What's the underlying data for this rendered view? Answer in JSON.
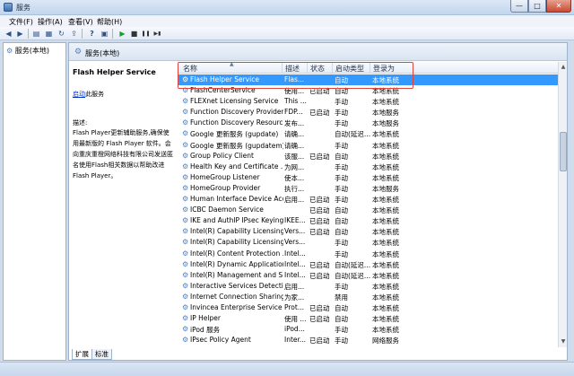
{
  "window": {
    "title": "服务",
    "controls": {
      "minimize": "—",
      "maximize": "□",
      "close": "✕"
    }
  },
  "menu": [
    "文件(F)",
    "操作(A)",
    "查看(V)",
    "帮助(H)"
  ],
  "toolbar": {
    "icons": [
      "back-icon",
      "forward-icon",
      "console-tree-icon",
      "properties-icon",
      "refresh-icon",
      "export-icon",
      "help-icon",
      "view-icon",
      "play-icon",
      "stop-icon",
      "pause-icon",
      "restart-icon"
    ],
    "glyphs": {
      "back": "◀",
      "forward": "▶",
      "tree": "▤",
      "props": "▦",
      "refresh": "↻",
      "export": "⇪",
      "help": "?",
      "view": "▣",
      "play": "▶",
      "stop": "■",
      "pause": "❚❚",
      "restart": "▶▮"
    }
  },
  "tree": {
    "node_label": "服务(本地)"
  },
  "header": {
    "title": "服务(本地)"
  },
  "detail": {
    "service_title": "Flash Helper Service",
    "start_link": "启动",
    "start_suffix": "此服务",
    "description_label": "描述:",
    "description": "Flash Player更新辅助服务,确保使用最新版的 Flash Player 软件。会向重庆重橙网络科技有限公司发送匿名使用Flash相关数据以帮助改进 Flash Player。"
  },
  "columns": {
    "name": "名称",
    "description": "描述",
    "status": "状态",
    "startup": "启动类型",
    "logon": "登录为"
  },
  "rows": [
    {
      "name": "Flash Helper Service",
      "desc": "Flas...",
      "status": "",
      "startup": "自动",
      "logon": "本地系统"
    },
    {
      "name": "FlashCenterService",
      "desc": "使用...",
      "status": "已启动",
      "startup": "自动",
      "logon": "本地系统"
    },
    {
      "name": "FLEXnet Licensing Service",
      "desc": "This ...",
      "status": "",
      "startup": "手动",
      "logon": "本地系统"
    },
    {
      "name": "Function Discovery Provider ...",
      "desc": "FDP...",
      "status": "已启动",
      "startup": "手动",
      "logon": "本地服务"
    },
    {
      "name": "Function Discovery Resourc...",
      "desc": "发布...",
      "status": "",
      "startup": "手动",
      "logon": "本地服务"
    },
    {
      "name": "Google 更新服务 (gupdate)",
      "desc": "请确...",
      "status": "",
      "startup": "自动(延迟...",
      "logon": "本地系统"
    },
    {
      "name": "Google 更新服务 (gupdatem)",
      "desc": "请确...",
      "status": "",
      "startup": "手动",
      "logon": "本地系统"
    },
    {
      "name": "Group Policy Client",
      "desc": "该服...",
      "status": "已启动",
      "startup": "自动",
      "logon": "本地系统"
    },
    {
      "name": "Health Key and Certificate ...",
      "desc": "为网...",
      "status": "",
      "startup": "手动",
      "logon": "本地系统"
    },
    {
      "name": "HomeGroup Listener",
      "desc": "使本...",
      "status": "",
      "startup": "手动",
      "logon": "本地系统"
    },
    {
      "name": "HomeGroup Provider",
      "desc": "执行...",
      "status": "",
      "startup": "手动",
      "logon": "本地服务"
    },
    {
      "name": "Human Interface Device Acc...",
      "desc": "启用...",
      "status": "已启动",
      "startup": "手动",
      "logon": "本地系统"
    },
    {
      "name": "ICBC Daemon Service",
      "desc": "",
      "status": "已启动",
      "startup": "自动",
      "logon": "本地系统"
    },
    {
      "name": "IKE and AuthIP IPsec Keying...",
      "desc": "IKEE...",
      "status": "已启动",
      "startup": "自动",
      "logon": "本地系统"
    },
    {
      "name": "Intel(R) Capability Licensing ...",
      "desc": "Vers...",
      "status": "已启动",
      "startup": "自动",
      "logon": "本地系统"
    },
    {
      "name": "Intel(R) Capability Licensing ...",
      "desc": "Vers...",
      "status": "",
      "startup": "手动",
      "logon": "本地系统"
    },
    {
      "name": "Intel(R) Content Protection ...",
      "desc": "Intel...",
      "status": "",
      "startup": "手动",
      "logon": "本地系统"
    },
    {
      "name": "Intel(R) Dynamic Application...",
      "desc": "Intel...",
      "status": "已启动",
      "startup": "自动(延迟...",
      "logon": "本地系统"
    },
    {
      "name": "Intel(R) Management and S...",
      "desc": "Intel...",
      "status": "已启动",
      "startup": "自动(延迟...",
      "logon": "本地系统"
    },
    {
      "name": "Interactive Services Detection",
      "desc": "启用...",
      "status": "",
      "startup": "手动",
      "logon": "本地系统"
    },
    {
      "name": "Internet Connection Sharing...",
      "desc": "为家...",
      "status": "",
      "startup": "禁用",
      "logon": "本地系统"
    },
    {
      "name": "Invincea Enterprise Service",
      "desc": "Prot...",
      "status": "已启动",
      "startup": "自动",
      "logon": "本地系统"
    },
    {
      "name": "IP Helper",
      "desc": "使用 ...",
      "status": "已启动",
      "startup": "自动",
      "logon": "本地系统"
    },
    {
      "name": "iPod 服务",
      "desc": "iPod...",
      "status": "",
      "startup": "手动",
      "logon": "本地系统"
    },
    {
      "name": "IPsec Policy Agent",
      "desc": "Inter...",
      "status": "已启动",
      "startup": "手动",
      "logon": "网络服务"
    }
  ],
  "tabs": [
    "扩展",
    "标准"
  ],
  "colors": {
    "selection": "#3399ff",
    "highlight_border": "#e0453a"
  }
}
